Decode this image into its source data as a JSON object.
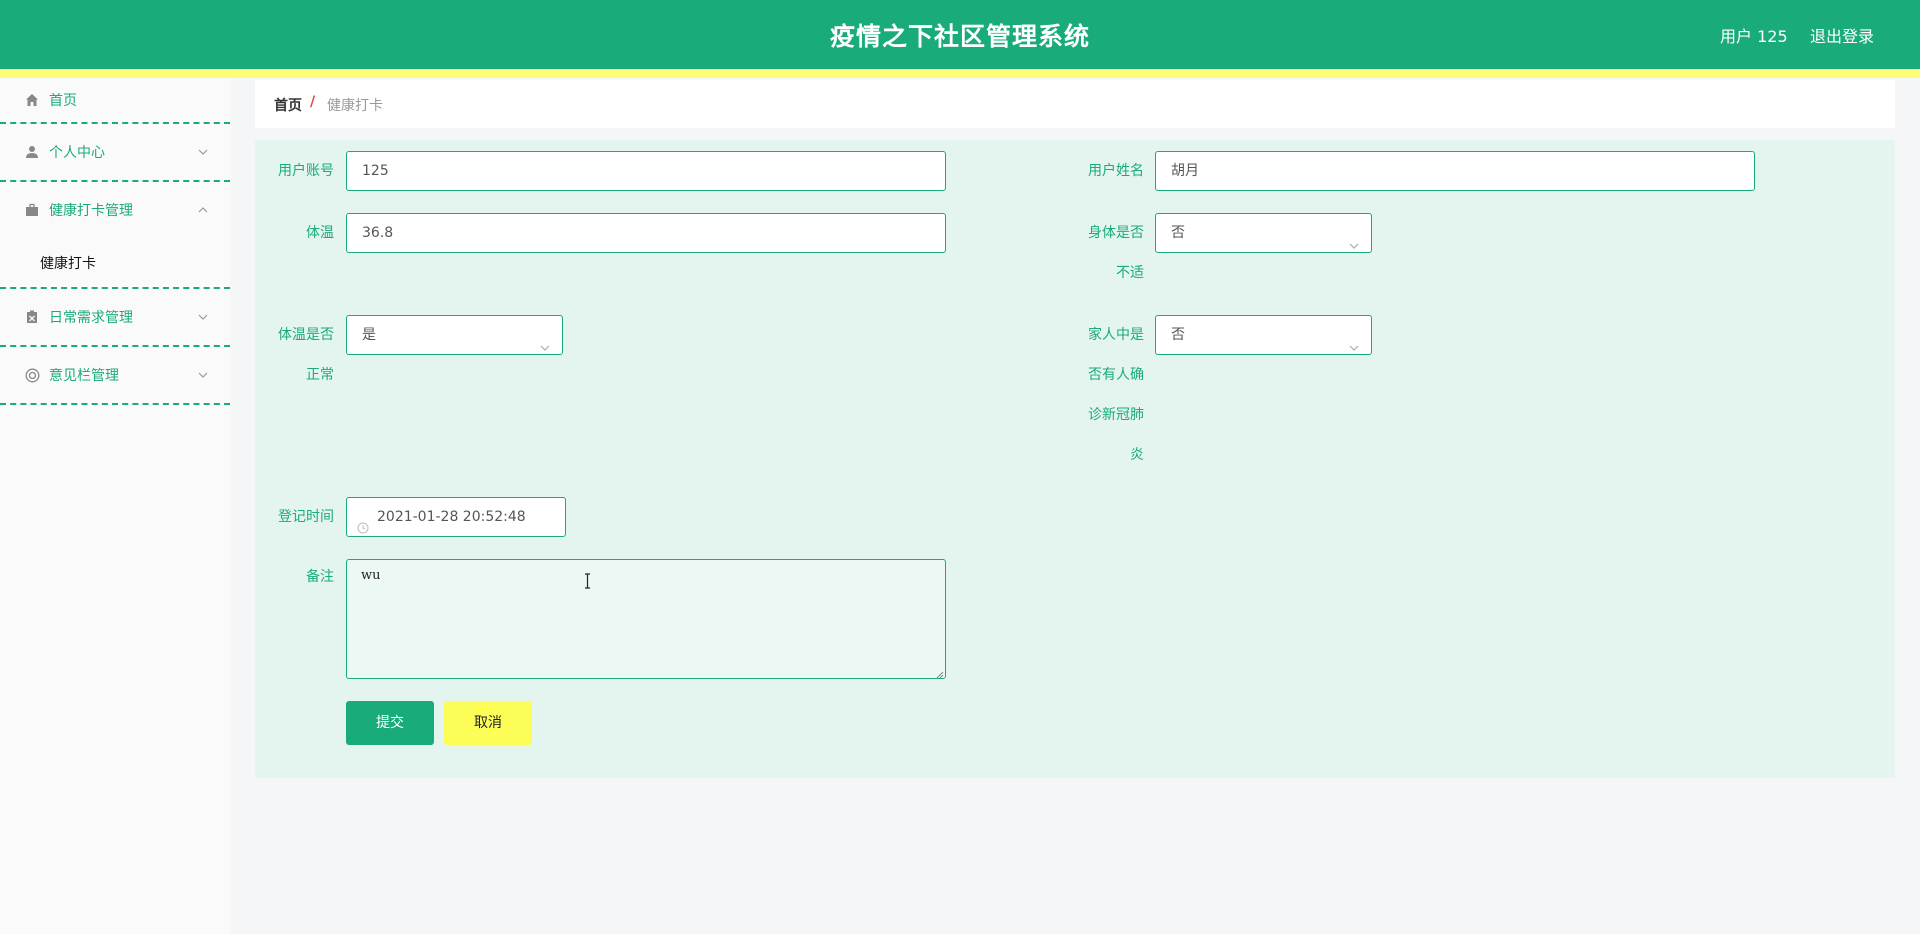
{
  "header": {
    "title": "疫情之下社区管理系统",
    "user": "用户 125",
    "logout": "退出登录",
    "bg_color": "#1aab7a",
    "stripe_color": "#fdfd7a"
  },
  "sidebar": {
    "items": [
      {
        "label": "首页",
        "icon": "home-icon"
      },
      {
        "label": "个人中心",
        "icon": "user-icon"
      },
      {
        "label": "健康打卡管理",
        "icon": "briefcase-icon",
        "expanded": true
      },
      {
        "label": "日常需求管理",
        "icon": "clipboard-icon"
      },
      {
        "label": "意见栏管理",
        "icon": "help-circle-icon"
      }
    ],
    "submenu": [
      {
        "label": "健康打卡"
      }
    ]
  },
  "breadcrumb": {
    "home": "首页",
    "separator": "/",
    "current": "健康打卡"
  },
  "form": {
    "account_label": "用户账号",
    "account_value": "125",
    "name_label": "用户姓名",
    "name_value": "胡月",
    "temp_label": "体温",
    "temp_value": "36.8",
    "unwell_label_l1": "身体是否",
    "unwell_label_l2": "不适",
    "unwell_value": "否",
    "temp_normal_label_l1": "体温是否",
    "temp_normal_label_l2": "正常",
    "temp_normal_value": "是",
    "family_label_l1": "家人中是",
    "family_label_l2": "否有人确",
    "family_label_l3": "诊新冠肺",
    "family_label_l4": "炎",
    "family_value": "否",
    "time_label": "登记时间",
    "time_value": "2021-01-28 20:52:48",
    "remark_label": "备注",
    "remark_value": "wu",
    "submit": "提交",
    "cancel": "取消"
  }
}
